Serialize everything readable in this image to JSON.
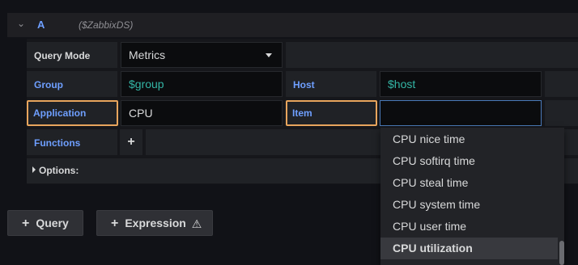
{
  "query": {
    "ref_id": "A",
    "datasource": "($ZabbixDS)"
  },
  "editor": {
    "query_mode": {
      "label": "Query Mode",
      "value": "Metrics"
    },
    "group": {
      "label": "Group",
      "value": "$group"
    },
    "host": {
      "label": "Host",
      "value": "$host"
    },
    "application": {
      "label": "Application",
      "value": "CPU"
    },
    "item": {
      "label": "Item",
      "value": ""
    },
    "functions": {
      "label": "Functions",
      "add": "+"
    },
    "options": {
      "label": "Options:"
    }
  },
  "dropdown": {
    "items": [
      "CPU nice time",
      "CPU softirq time",
      "CPU steal time",
      "CPU system time",
      "CPU user time",
      "CPU utilization"
    ],
    "active_index": 5
  },
  "buttons": {
    "query": {
      "icon": "+",
      "label": "Query"
    },
    "expression": {
      "icon": "+",
      "label": "Expression",
      "warn": "⚠"
    }
  },
  "colors": {
    "accent_blue": "#6e9fff",
    "highlight_orange": "#e8a55d",
    "variable_teal": "#33b5a5"
  }
}
